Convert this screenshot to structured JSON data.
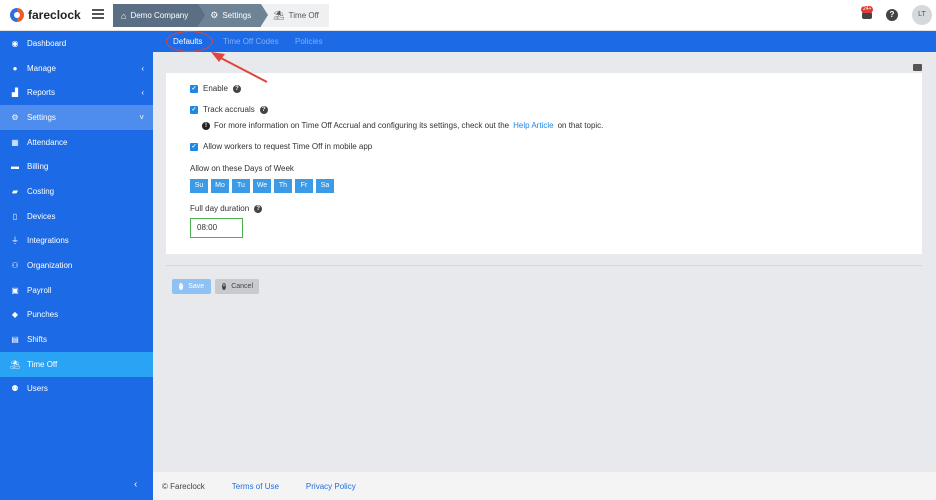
{
  "app": {
    "name": "fareclock"
  },
  "breadcrumbs": [
    {
      "label": "Demo Company",
      "icon": "home-icon"
    },
    {
      "label": "Settings",
      "icon": "gear-icon"
    },
    {
      "label": "Time Off",
      "icon": "beach-umbrella-icon"
    }
  ],
  "header": {
    "notifications_badge": "24+",
    "help": "?",
    "avatar_initials": "LT"
  },
  "sidebar": {
    "items": [
      {
        "label": "Dashboard"
      },
      {
        "label": "Manage",
        "arrow": "‹"
      },
      {
        "label": "Reports",
        "arrow": "‹"
      },
      {
        "label": "Settings",
        "arrow": "˅"
      },
      {
        "label": "Attendance"
      },
      {
        "label": "Billing"
      },
      {
        "label": "Costing"
      },
      {
        "label": "Devices"
      },
      {
        "label": "Integrations"
      },
      {
        "label": "Organization"
      },
      {
        "label": "Payroll"
      },
      {
        "label": "Punches"
      },
      {
        "label": "Shifts"
      },
      {
        "label": "Time Off"
      },
      {
        "label": "Users"
      }
    ],
    "collapse": "‹"
  },
  "tabs": [
    {
      "label": "Defaults"
    },
    {
      "label": "Time Off Codes"
    },
    {
      "label": "Policies"
    }
  ],
  "form": {
    "enable_label": "Enable",
    "track_label": "Track accruals",
    "info_prefix": "For more information on Time Off Accrual and configuring its settings, check out the",
    "info_link": "Help Article",
    "info_suffix": "on that topic.",
    "mobile_label": "Allow workers to request Time Off in mobile app",
    "days_label": "Allow on these Days of Week",
    "days": [
      "Su",
      "Mo",
      "Tu",
      "We",
      "Th",
      "Fr",
      "Sa"
    ],
    "duration_label": "Full day duration",
    "duration_value": "08:00"
  },
  "actions": {
    "save": "Save",
    "cancel": "Cancel"
  },
  "footer": {
    "copyright": "© Fareclock",
    "terms": "Terms of Use",
    "privacy": "Privacy Policy"
  },
  "colors": {
    "sidebar": "#1c6ae5",
    "active": "#2aa3f5",
    "annotation": "#e0463d"
  }
}
